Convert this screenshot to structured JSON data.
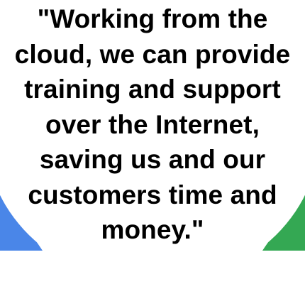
{
  "colors": {
    "background": "#ffffff",
    "left_accent": "#4a86e8",
    "right_accent": "#34a853",
    "quote_fill": "#ffffff",
    "text": "#000000"
  },
  "quote": {
    "lines": [
      "\"Working from the",
      "cloud, we can provide",
      "training and support",
      "over the Internet,",
      "saving us and our",
      "customers time and",
      "money.\""
    ]
  }
}
